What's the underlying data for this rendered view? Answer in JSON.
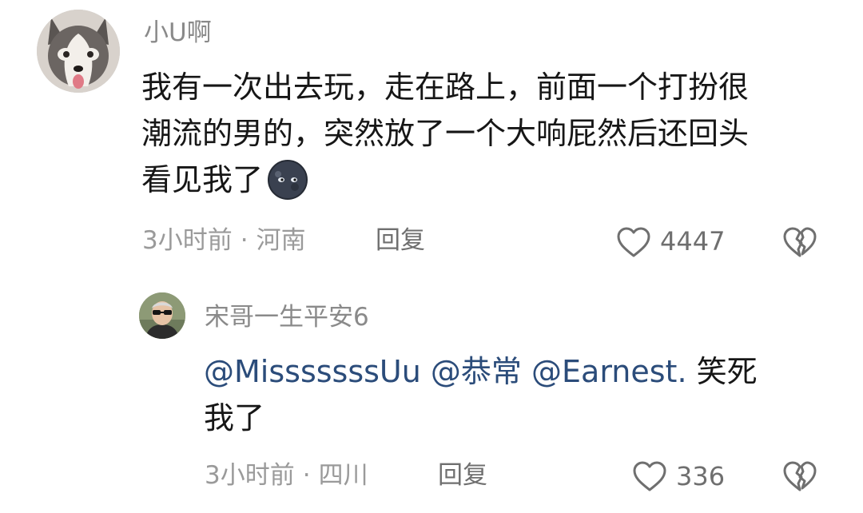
{
  "comment": {
    "username": "小U啊",
    "text_lines": [
      "我有一次出去玩，走在路上，前面一个打扮很",
      "潮流的男的，突然放了一个大响屁然后还回头",
      "看见我了"
    ],
    "emoji_name": "new-moon-face-emoji",
    "time": "3小时前",
    "location": "河南",
    "reply_label": "回复",
    "like_count": "4447",
    "avatar_icon": "husky-dog-avatar"
  },
  "reply_comment": {
    "username": "宋哥一生平安6",
    "mentions": [
      "@MisssssssUu",
      "@恭常",
      "@Earnest."
    ],
    "text_after_mentions": "笑死",
    "text_line2": "我了",
    "time": "3小时前",
    "location": "四川",
    "reply_label": "回复",
    "like_count": "336",
    "avatar_icon": "man-with-sunglasses-avatar"
  },
  "separator": "·",
  "colors": {
    "mention": "#2b4c7a",
    "meta_gray": "#9a9a9a",
    "text": "#161616"
  }
}
